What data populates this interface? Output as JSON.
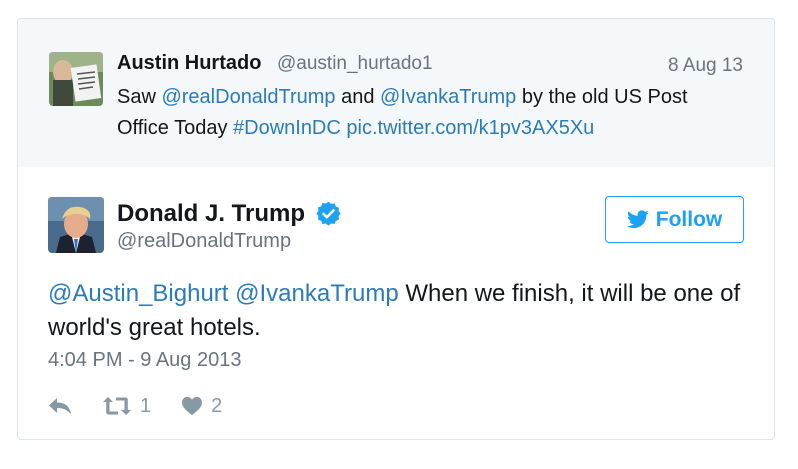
{
  "parent_tweet": {
    "author_name": "Austin Hurtado",
    "author_handle": "@austin_hurtado1",
    "date": "8 Aug 13",
    "text_parts": {
      "t1": "Saw ",
      "m1": "@realDonaldTrump",
      "t2": " and ",
      "m2": "@IvankaTrump",
      "t3": " by the old US Post Office Today ",
      "h1": "#DownInDC",
      "t4": " ",
      "l1": "pic.twitter.com/k1pv3AX5Xu"
    }
  },
  "main_tweet": {
    "author_name": "Donald J. Trump",
    "author_handle": "@realDonaldTrump",
    "verified_icon": "verified-badge-icon",
    "follow_label": "Follow",
    "text_parts": {
      "m1": "@Austin_Bighurt",
      "t1": " ",
      "m2": "@IvankaTrump",
      "t2": " When we finish, it will be one of world's great hotels."
    },
    "timestamp": "4:04 PM - 9 Aug 2013",
    "actions": {
      "reply_icon": "reply-icon",
      "retweet_icon": "retweet-icon",
      "retweet_count": "1",
      "like_icon": "heart-icon",
      "like_count": "2"
    }
  },
  "colors": {
    "link": "#2b7bb9",
    "accent": "#1da1f2",
    "muted": "#66757f",
    "parent_bg": "#f5f8fa"
  }
}
